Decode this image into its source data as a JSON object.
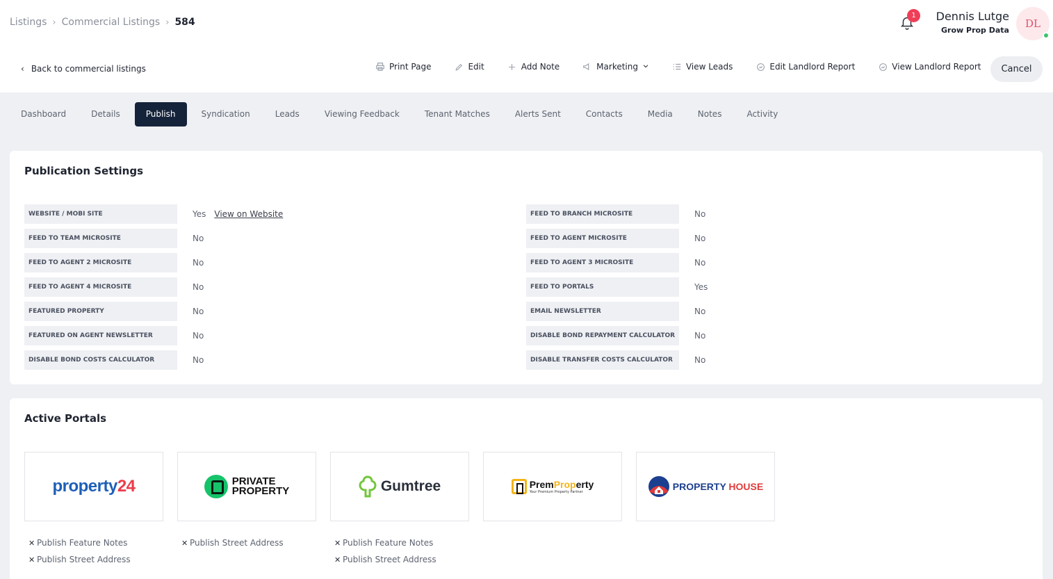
{
  "breadcrumb": {
    "items": [
      "Listings",
      "Commercial Listings"
    ],
    "current": "584"
  },
  "notifications": {
    "count": "1"
  },
  "user": {
    "name": "Dennis Lutge",
    "org": "Grow Prop Data",
    "initials": "DL"
  },
  "actionbar": {
    "back_label": "Back to commercial listings",
    "print": "Print Page",
    "edit": "Edit",
    "add_note": "Add Note",
    "marketing": "Marketing",
    "view_leads": "View Leads",
    "edit_report": "Edit Landlord Report",
    "view_report": "View Landlord Report",
    "cancel": "Cancel"
  },
  "tabs": [
    "Dashboard",
    "Details",
    "Publish",
    "Syndication",
    "Leads",
    "Viewing Feedback",
    "Tenant Matches",
    "Alerts Sent",
    "Contacts",
    "Media",
    "Notes",
    "Activity"
  ],
  "active_tab": "Publish",
  "publication": {
    "title": "Publication Settings",
    "view_link": "View on Website",
    "left": [
      {
        "label": "WEBSITE / MOBI SITE",
        "value": "Yes"
      },
      {
        "label": "FEED TO TEAM MICROSITE",
        "value": "No"
      },
      {
        "label": "FEED TO AGENT 2 MICROSITE",
        "value": "No"
      },
      {
        "label": "FEED TO AGENT 4 MICROSITE",
        "value": "No"
      },
      {
        "label": "FEATURED PROPERTY",
        "value": "No"
      },
      {
        "label": "FEATURED ON AGENT NEWSLETTER",
        "value": "No"
      },
      {
        "label": "DISABLE BOND COSTS CALCULATOR",
        "value": "No"
      }
    ],
    "right": [
      {
        "label": "FEED TO BRANCH MICROSITE",
        "value": "No"
      },
      {
        "label": "FEED TO AGENT MICROSITE",
        "value": "No"
      },
      {
        "label": "FEED TO AGENT 3 MICROSITE",
        "value": "No"
      },
      {
        "label": "FEED TO PORTALS",
        "value": "Yes"
      },
      {
        "label": "EMAIL NEWSLETTER",
        "value": "No"
      },
      {
        "label": "DISABLE BOND REPAYMENT CALCULATOR",
        "value": "No"
      },
      {
        "label": "DISABLE TRANSFER COSTS CALCULATOR",
        "value": "No"
      }
    ]
  },
  "portals": {
    "title": "Active Portals",
    "items": [
      {
        "name": "property24",
        "logo_a": "property",
        "logo_b": "24",
        "options": [
          "Publish Feature Notes",
          "Publish Street Address"
        ]
      },
      {
        "name": "Private Property",
        "logo_a": "PRIVATE",
        "logo_b": "PROPERTY",
        "options": [
          "Publish Street Address"
        ]
      },
      {
        "name": "Gumtree",
        "logo_a": "Gumtree",
        "options": [
          "Publish Feature Notes",
          "Publish Street Address"
        ]
      },
      {
        "name": "PremProperty",
        "logo_a": "Prem",
        "logo_b": "Prop",
        "logo_c": "erty",
        "logo_sub": "Your Premium Property Partner",
        "options": []
      },
      {
        "name": "Property House",
        "logo_a": "PROPERTY",
        "logo_b": "HOUSE",
        "options": []
      }
    ]
  },
  "colors": {
    "active_tab": "#15233a",
    "badge": "#ef3e57",
    "online": "#3cc46d"
  }
}
